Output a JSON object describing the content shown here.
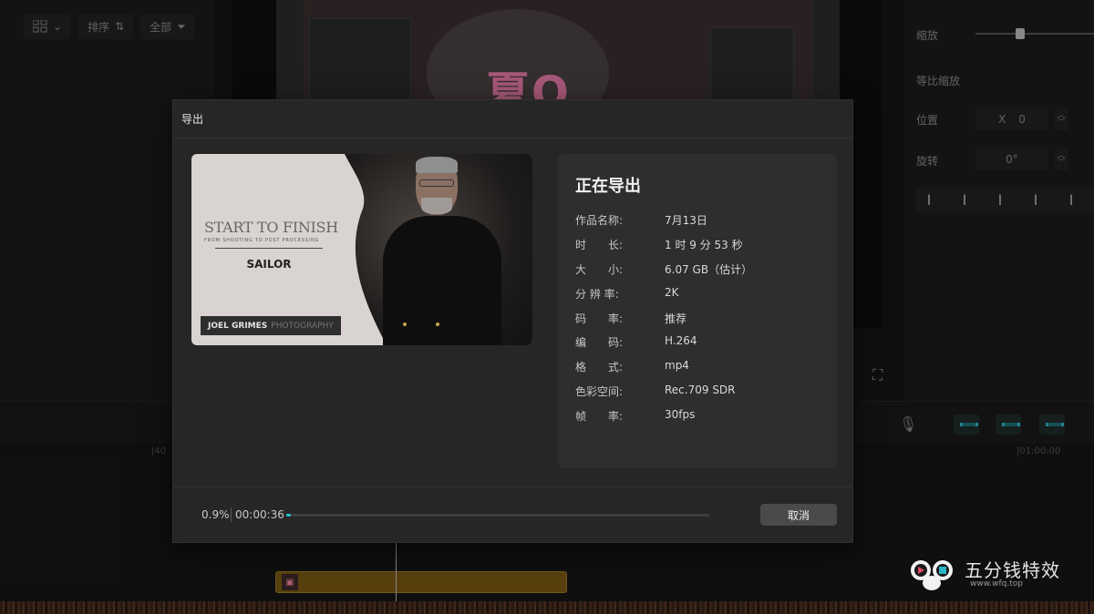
{
  "background": {
    "toolbar": {
      "sort_label": "排序",
      "filter_label": "全部"
    },
    "properties": {
      "scale_label": "缩放",
      "uniform_scale_label": "等比缩放",
      "position_label": "位置",
      "position_x_label": "X",
      "position_x_value": "0",
      "rotation_label": "旋转",
      "rotation_value": "0°"
    },
    "timeline": {
      "timecode_left": "|40",
      "timecode_right": "|01:00:00"
    },
    "preview_text": "夏Q"
  },
  "dialog": {
    "title": "导出",
    "thumbnail": {
      "title": "START TO FINISH",
      "subtitle": "FROM SHOOTING TO POST PROCESSING",
      "name": "SAILOR",
      "credit_name": "JOEL GRIMES",
      "credit_suffix": "PHOTOGRAPHY"
    },
    "info": {
      "heading": "正在导出",
      "rows": [
        {
          "label": "作品名称:",
          "value": "7月13日"
        },
        {
          "label": "时　　长:",
          "value": "1 时 9 分 53 秒"
        },
        {
          "label": "大　　小:",
          "value": "6.07 GB（估计）"
        },
        {
          "label": "分 辨 率:",
          "value": "2K"
        },
        {
          "label": "码　　率:",
          "value": "推荐"
        },
        {
          "label": "编　　码:",
          "value": "H.264"
        },
        {
          "label": "格　　式:",
          "value": "mp4"
        },
        {
          "label": "色彩空间:",
          "value": "Rec.709 SDR"
        },
        {
          "label": "帧　　率:",
          "value": "30fps"
        }
      ]
    },
    "progress": {
      "percent_text": "0.9%",
      "elapsed": "00:00:36",
      "fraction": 0.009
    },
    "cancel_label": "取消"
  },
  "watermark": {
    "text": "五分钱特效",
    "url": "www.wfq.top"
  },
  "colors": {
    "accent": "#26c0d3",
    "dialog_bg": "#262626",
    "panel_bg": "#2e2e2e"
  }
}
